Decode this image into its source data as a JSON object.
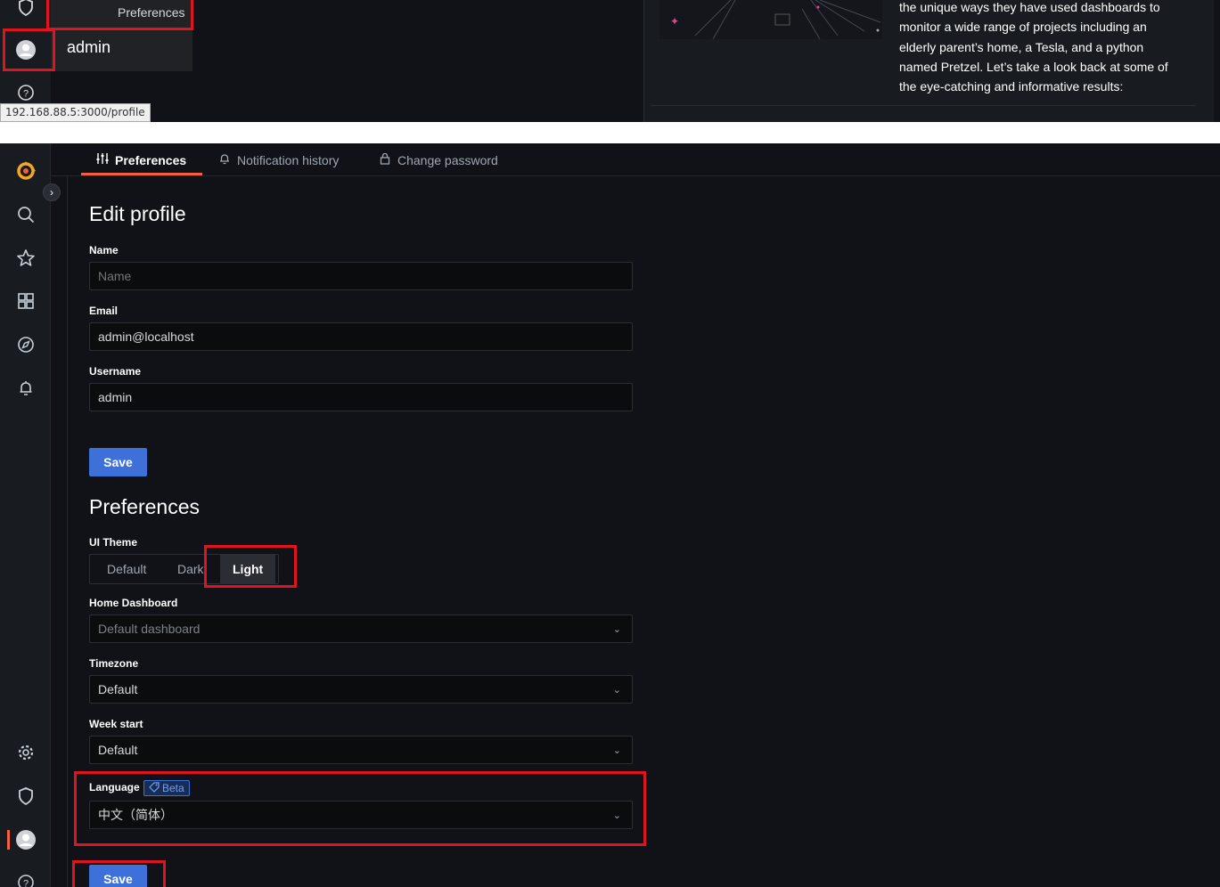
{
  "top_menu": {
    "preferences_item": "Preferences",
    "user_name": "admin",
    "status_url": "192.168.88.5:3000/profile"
  },
  "news": {
    "lines": [
      "the unique ways they have used dashboards to",
      "monitor a wide range of projects including an",
      "elderly parent’s home, a Tesla, and a python",
      "named Pretzel. Let’s take a look back at some of",
      "the eye-catching and informative results:"
    ]
  },
  "tabs": [
    {
      "label": "Preferences",
      "icon": "sliders-icon"
    },
    {
      "label": "Notification history",
      "icon": "bell-icon"
    },
    {
      "label": "Change password",
      "icon": "lock-icon"
    }
  ],
  "edit_profile": {
    "title": "Edit profile",
    "name_label": "Name",
    "name_placeholder": "Name",
    "email_label": "Email",
    "email_value": "admin@localhost",
    "username_label": "Username",
    "username_value": "admin",
    "save_label": "Save"
  },
  "preferences": {
    "title": "Preferences",
    "theme_label": "UI Theme",
    "theme_options": [
      "Default",
      "Dark",
      "Light"
    ],
    "theme_selected": "Light",
    "home_dashboard_label": "Home Dashboard",
    "home_dashboard_value": "Default dashboard",
    "timezone_label": "Timezone",
    "timezone_value": "Default",
    "week_start_label": "Week start",
    "week_start_value": "Default",
    "language_label": "Language",
    "language_badge": "Beta",
    "language_value": "中文（简体）",
    "save_label": "Save"
  },
  "colors": {
    "accent": "#3d71d9",
    "tab_active": "#f55f3e",
    "highlight": "#e0141e",
    "background": "#111217"
  }
}
